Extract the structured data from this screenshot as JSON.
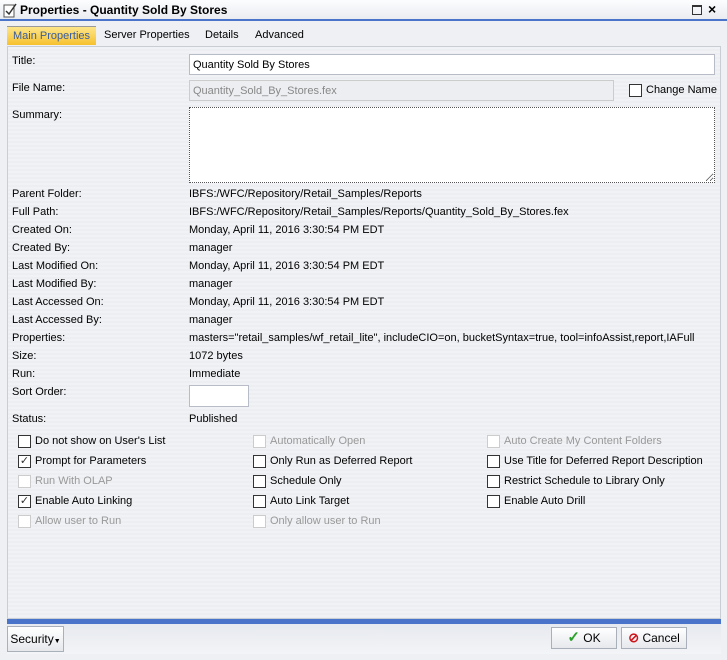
{
  "window": {
    "title": "Properties - Quantity Sold By Stores"
  },
  "tabs": [
    {
      "label": "Main Properties"
    },
    {
      "label": "Server Properties"
    },
    {
      "label": "Details"
    },
    {
      "label": "Advanced"
    }
  ],
  "form": {
    "title_label": "Title:",
    "title_value": "Quantity Sold By Stores",
    "file_label": "File Name:",
    "file_value": "Quantity_Sold_By_Stores.fex",
    "change_name": "Change Name",
    "summary_label": "Summary:",
    "summary_value": "",
    "sort_label": "Sort Order:",
    "sort_value": "",
    "status_label": "Status:",
    "status_value": "Published"
  },
  "info": [
    {
      "label": "Parent Folder:",
      "value": "IBFS:/WFC/Repository/Retail_Samples/Reports"
    },
    {
      "label": "Full Path:",
      "value": "IBFS:/WFC/Repository/Retail_Samples/Reports/Quantity_Sold_By_Stores.fex"
    },
    {
      "label": "Created On:",
      "value": "Monday, April 11, 2016 3:30:54 PM EDT"
    },
    {
      "label": "Created By:",
      "value": "manager"
    },
    {
      "label": "Last Modified On:",
      "value": "Monday, April 11, 2016 3:30:54 PM EDT"
    },
    {
      "label": "Last Modified By:",
      "value": "manager"
    },
    {
      "label": "Last Accessed On:",
      "value": "Monday, April 11, 2016 3:30:54 PM EDT"
    },
    {
      "label": "Last Accessed By:",
      "value": "manager"
    },
    {
      "label": "Properties:",
      "value": "masters=\"retail_samples/wf_retail_lite\", includeCIO=on, bucketSyntax=true, tool=infoAssist,report,IAFull"
    },
    {
      "label": "Size:",
      "value": "1072 bytes"
    },
    {
      "label": "Run:",
      "value": "Immediate"
    }
  ],
  "checkboxes": [
    [
      {
        "label": "Do not show on User's List",
        "checked": false,
        "disabled": false
      },
      {
        "label": "Prompt for Parameters",
        "checked": true,
        "disabled": false
      },
      {
        "label": "Run With OLAP",
        "checked": false,
        "disabled": true
      },
      {
        "label": "Enable Auto Linking",
        "checked": true,
        "disabled": false
      },
      {
        "label": "Allow user to Run",
        "checked": false,
        "disabled": true
      }
    ],
    [
      {
        "label": "Automatically Open",
        "checked": false,
        "disabled": true
      },
      {
        "label": "Only Run as Deferred Report",
        "checked": false,
        "disabled": false
      },
      {
        "label": "Schedule Only",
        "checked": false,
        "disabled": false
      },
      {
        "label": "Auto Link Target",
        "checked": false,
        "disabled": false
      },
      {
        "label": "Only allow user to Run",
        "checked": false,
        "disabled": true
      }
    ],
    [
      {
        "label": "Auto Create My Content Folders",
        "checked": false,
        "disabled": true
      },
      {
        "label": "Use Title for Deferred Report Description",
        "checked": false,
        "disabled": false
      },
      {
        "label": "Restrict Schedule to Library Only",
        "checked": false,
        "disabled": false
      },
      {
        "label": "Enable Auto Drill",
        "checked": false,
        "disabled": false
      }
    ]
  ],
  "footer": {
    "security": "Security",
    "ok": "OK",
    "cancel": "Cancel"
  },
  "colors": {
    "accent": "#4a74c9",
    "tab_active": "#f6c12e",
    "ok_check": "#2aa12a",
    "cancel_red": "#d0141b"
  }
}
